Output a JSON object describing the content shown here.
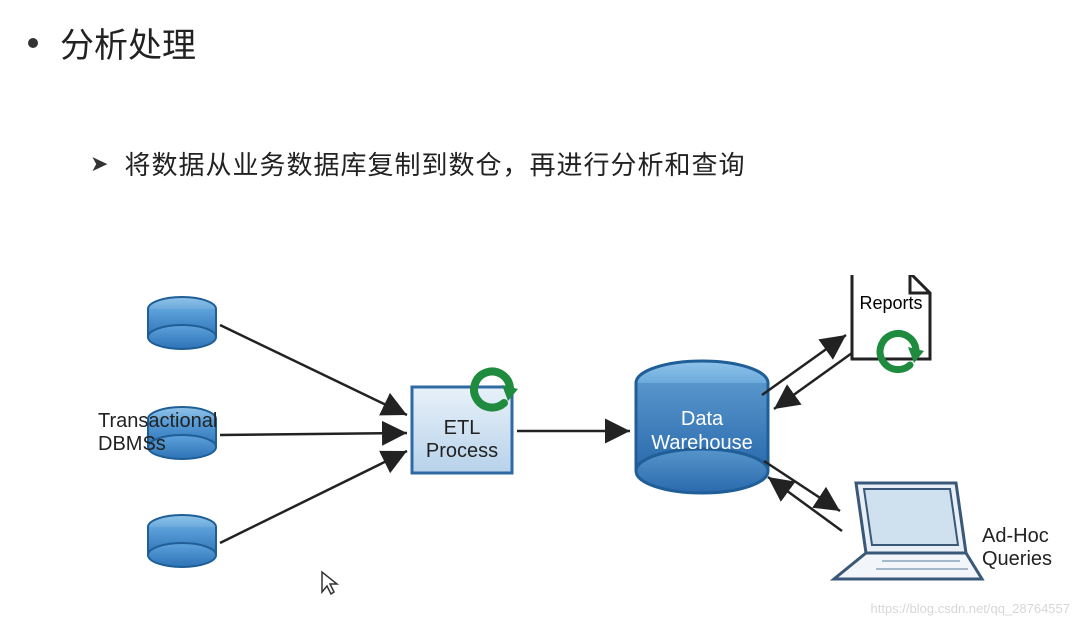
{
  "title": "分析处理",
  "subtitle": "将数据从业务数据库复制到数仓，再进行分析和查询",
  "diagram": {
    "dbms_label": "Transactional\nDBMSs",
    "etl_label": "ETL\nProcess",
    "dw_label": "Data\nWarehouse",
    "reports_label": "Reports",
    "adhoc_label": "Ad-Hoc\nQueries"
  },
  "watermark": "https://blog.csdn.net/qq_28764557"
}
